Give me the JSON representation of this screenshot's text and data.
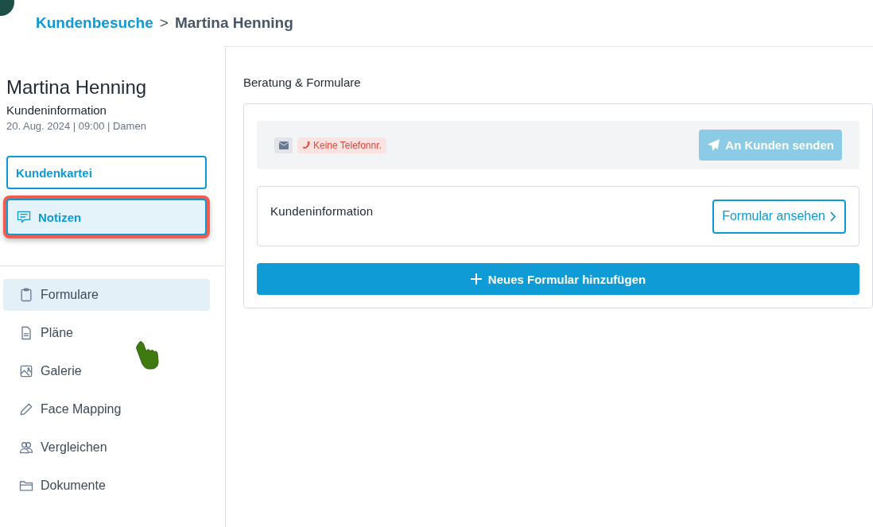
{
  "breadcrumb": {
    "parent": "Kundenbesuche",
    "separator": ">",
    "current": "Martina Henning"
  },
  "customer": {
    "name": "Martina Henning",
    "subtitle": "Kundeninformation",
    "meta": "20. Aug. 2024 | 09:00 | Damen"
  },
  "tabs": [
    {
      "label": "Kundenkartei",
      "selected": false,
      "highlighted": false,
      "kind": "plain"
    },
    {
      "label": "Notizen",
      "selected": true,
      "highlighted": true,
      "kind": "note"
    }
  ],
  "nav": [
    {
      "label": "Formulare",
      "kind": "clipboard",
      "selected": true
    },
    {
      "label": "Pläne",
      "kind": "document",
      "selected": false
    },
    {
      "label": "Galerie",
      "kind": "image",
      "selected": false
    },
    {
      "label": "Face Mapping",
      "kind": "pencil",
      "selected": false
    },
    {
      "label": "Vergleichen",
      "kind": "users",
      "selected": false
    },
    {
      "label": "Dokumente",
      "kind": "folder",
      "selected": false
    }
  ],
  "section": {
    "title": "Beratung & Formulare",
    "contact": {
      "phone_tag": "Keine Telefonnr.",
      "send_button": {
        "label": "An Kunden senden",
        "disabled": true
      }
    },
    "forms": [
      {
        "title": "Kundeninformation",
        "action": "Formular ansehen"
      }
    ],
    "add_button": "Neues Formular hinzufügen"
  }
}
